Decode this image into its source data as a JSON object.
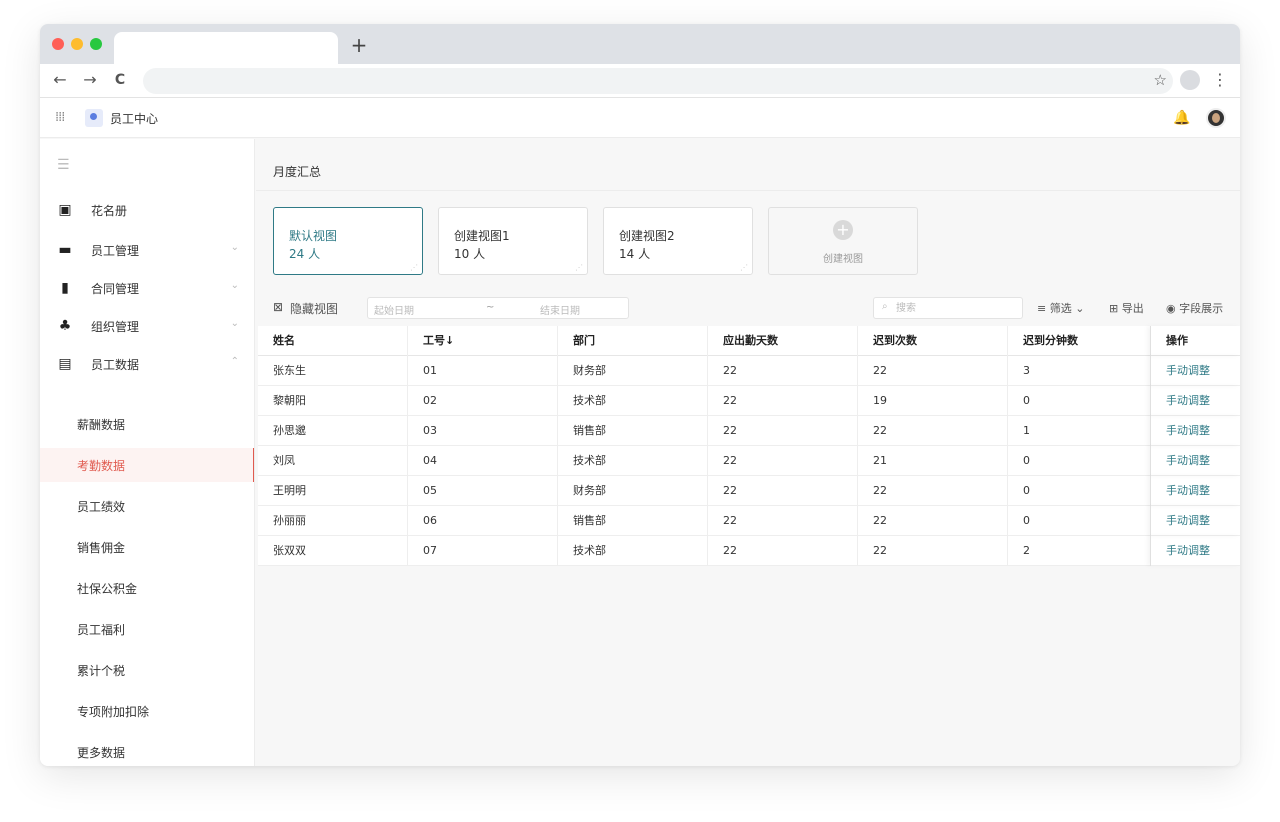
{
  "browser": {
    "new_tab_icon": "+",
    "nav": {
      "back": "←",
      "forward": "→",
      "reload": "C"
    },
    "bookmark_icon": "star-icon",
    "menu_icon": "⋮"
  },
  "app": {
    "name": "员工中心",
    "grid_icon": "apps-grid-icon",
    "header_icons": [
      "bell-icon",
      "user-avatar"
    ]
  },
  "sidebar": {
    "items": [
      {
        "label": "花名册",
        "icon": "contacts-book-icon",
        "chevron": ""
      },
      {
        "label": "员工管理",
        "icon": "folder-user-icon",
        "chevron": "⌄"
      },
      {
        "label": "合同管理",
        "icon": "contract-file-icon",
        "chevron": "⌄"
      },
      {
        "label": "组织管理",
        "icon": "org-chart-icon",
        "chevron": "⌄"
      },
      {
        "label": "员工数据",
        "icon": "id-card-icon",
        "chevron": "⌃"
      }
    ],
    "subitems": [
      {
        "label": "薪酬数据",
        "active": false
      },
      {
        "label": "考勤数据",
        "active": true
      },
      {
        "label": "员工绩效",
        "active": false
      },
      {
        "label": "销售佣金",
        "active": false
      },
      {
        "label": "社保公积金",
        "active": false
      },
      {
        "label": "员工福利",
        "active": false
      },
      {
        "label": "累计个税",
        "active": false
      },
      {
        "label": "专项附加扣除",
        "active": false
      },
      {
        "label": "更多数据",
        "active": false
      }
    ],
    "accent": "#e05a4f"
  },
  "page": {
    "title": "月度汇总"
  },
  "views": [
    {
      "name": "默认视图",
      "count": "24 人",
      "selected": true
    },
    {
      "name": "创建视图1",
      "count": "10 人",
      "selected": false
    },
    {
      "name": "创建视图2",
      "count": "14 人",
      "selected": false
    }
  ],
  "create_view": {
    "label": "创建视图",
    "icon": "+"
  },
  "toolbar": {
    "hide_view": "隐藏视图",
    "start_date_placeholder": "起始日期",
    "separator": "~",
    "end_date_placeholder": "结束日期",
    "search_placeholder": "搜索",
    "filter": "筛选",
    "export": "导出",
    "fields": "字段展示"
  },
  "table": {
    "columns": [
      "姓名",
      "工号↓",
      "部门",
      "应出勤天数",
      "迟到次数",
      "迟到分钟数",
      "操作"
    ],
    "rows": [
      [
        "张东生",
        "01",
        "财务部",
        "22",
        "22",
        "3",
        "手动调整"
      ],
      [
        "黎朝阳",
        "02",
        "技术部",
        "22",
        "19",
        "0",
        "手动调整"
      ],
      [
        "孙思邈",
        "03",
        "销售部",
        "22",
        "22",
        "1",
        "手动调整"
      ],
      [
        "刘凤",
        "04",
        "技术部",
        "22",
        "21",
        "0",
        "手动调整"
      ],
      [
        "王明明",
        "05",
        "财务部",
        "22",
        "22",
        "0",
        "手动调整"
      ],
      [
        "孙丽丽",
        "06",
        "销售部",
        "22",
        "22",
        "0",
        "手动调整"
      ],
      [
        "张双双",
        "07",
        "技术部",
        "22",
        "22",
        "2",
        "手动调整"
      ]
    ]
  },
  "colors": {
    "accent": "#2f7a86",
    "active_nav": "#e05a4f"
  }
}
